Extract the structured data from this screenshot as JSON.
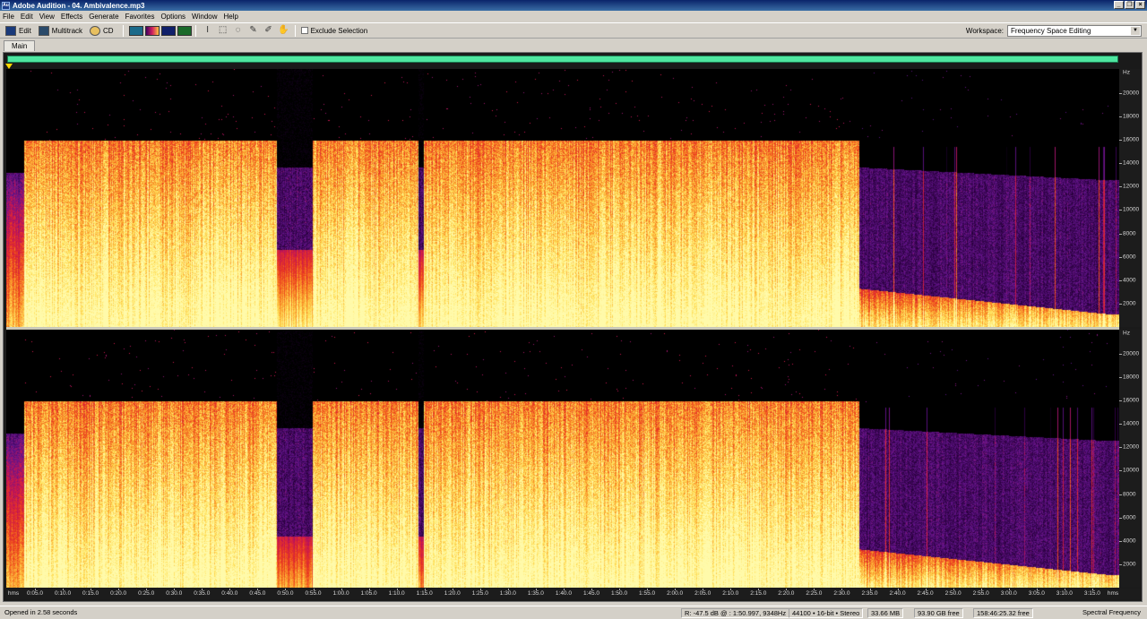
{
  "window": {
    "title": "Adobe Audition - 04. Ambivalence.mp3",
    "app_icon": "Au",
    "controls": [
      "minimize-icon",
      "restore-icon",
      "close-icon"
    ]
  },
  "menu": [
    "File",
    "Edit",
    "View",
    "Effects",
    "Generate",
    "Favorites",
    "Options",
    "Window",
    "Help"
  ],
  "toolbar": {
    "edit_label": "Edit",
    "multitrack_label": "Multitrack",
    "cd_label": "CD",
    "exclude_selection_label": "Exclude Selection",
    "workspace_label": "Workspace:",
    "workspace_value": "Frequency Space Editing"
  },
  "tabs": {
    "main": "Main"
  },
  "spectrogram": {
    "freq_unit": "Hz",
    "freq_labels": [
      "20000",
      "18000",
      "16000",
      "14000",
      "12000",
      "10000",
      "8000",
      "6000",
      "4000",
      "2000"
    ],
    "time_unit": "hms",
    "time_labels": [
      "0:05.0",
      "0:10.0",
      "0:15.0",
      "0:20.0",
      "0:25.0",
      "0:30.0",
      "0:35.0",
      "0:40.0",
      "0:45.0",
      "0:50.0",
      "0:55.0",
      "1:00.0",
      "1:05.0",
      "1:10.0",
      "1:15.0",
      "1:20.0",
      "1:25.0",
      "1:30.0",
      "1:35.0",
      "1:40.0",
      "1:45.0",
      "1:50.0",
      "1:55.0",
      "2:00.0",
      "2:05.0",
      "2:10.0",
      "2:15.0",
      "2:20.0",
      "2:25.0",
      "2:30.0",
      "2:35.0",
      "2:40.0",
      "2:45.0",
      "2:50.0",
      "2:55.0",
      "3:00.0",
      "3:05.0",
      "3:10.0",
      "3:15.0"
    ]
  },
  "status": {
    "message": "Opened in 2.58 seconds",
    "cursor": "R: -47.5 dB @ : 1:50.997, 9348Hz",
    "format": "44100 • 16-bit • Stereo",
    "size": "33.66 MB",
    "free": "93.90 GB free",
    "time_free": "158:46:25.32 free",
    "view": "Spectral Frequency"
  }
}
